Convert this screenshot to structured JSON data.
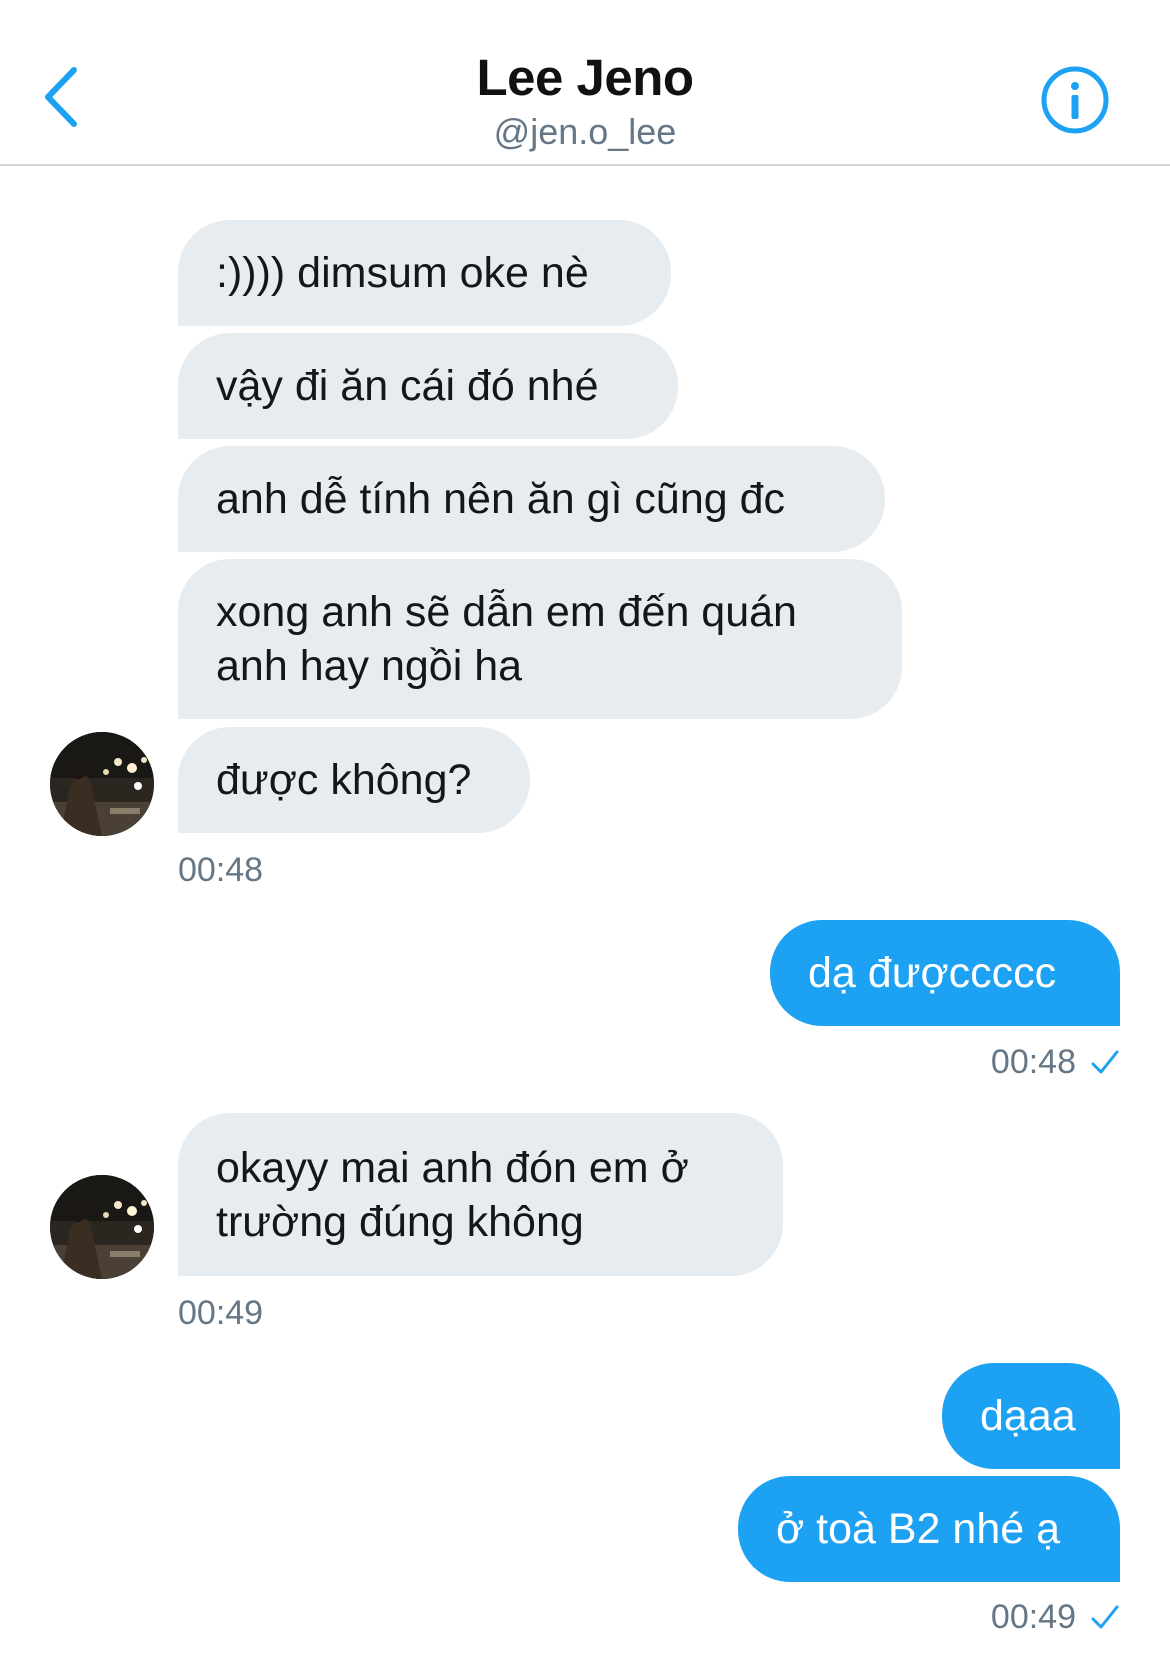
{
  "header": {
    "title": "Lee Jeno",
    "handle": "@jen.o_lee"
  },
  "messages": [
    {
      "from": "them",
      "text": ":)))) dimsum oke nè"
    },
    {
      "from": "them",
      "text": "vậy đi ăn cái đó nhé"
    },
    {
      "from": "them",
      "text": "anh dễ tính nên ăn gì cũng đc"
    },
    {
      "from": "them",
      "lines": [
        "xong anh sẽ dẫn em đến quán",
        "anh hay ngồi ha"
      ]
    },
    {
      "from": "them",
      "text": "được không?"
    },
    {
      "from": "me",
      "text": "dạ đượccccc"
    },
    {
      "from": "them",
      "lines": [
        "okayy mai anh đón em ở",
        "trường đúng không"
      ]
    },
    {
      "from": "me",
      "text": "dạaa"
    },
    {
      "from": "me",
      "text": "ở toà B2 nhé ạ"
    }
  ],
  "timestamps": {
    "group1": "00:48",
    "group2": "00:48",
    "group3": "00:49",
    "group4": "00:49"
  },
  "colors": {
    "accent": "#1da1f2",
    "incoming_bubble": "#e6ecf0",
    "muted_text": "#657786"
  },
  "icons": {
    "back": "chevron-left-icon",
    "info": "info-circle-icon",
    "sent": "checkmark-icon"
  }
}
